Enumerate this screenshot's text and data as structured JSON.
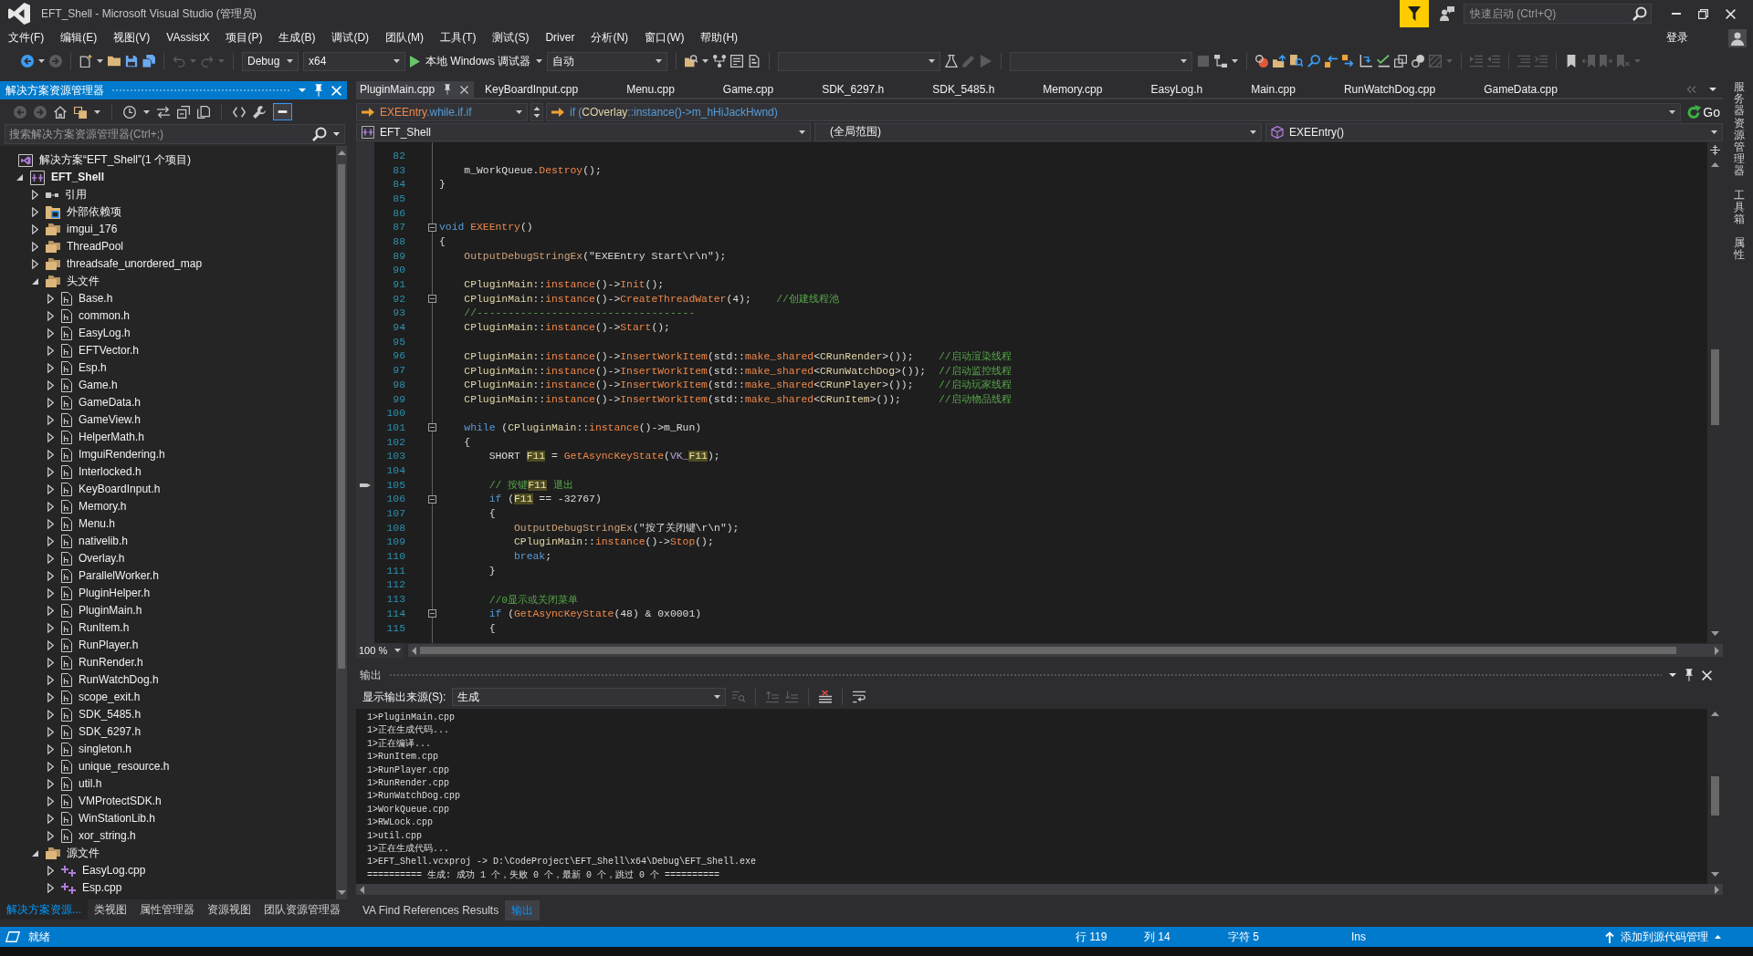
{
  "window": {
    "title": "EFT_Shell - Microsoft Visual Studio (管理员)",
    "quick_launch": {
      "placeholder": "快速启动 (Ctrl+Q)"
    },
    "sign_in": "登录"
  },
  "menu": [
    "文件(F)",
    "编辑(E)",
    "视图(V)",
    "VAssistX",
    "项目(P)",
    "生成(B)",
    "调试(D)",
    "团队(M)",
    "工具(T)",
    "测试(S)",
    "Driver",
    "分析(N)",
    "窗口(W)",
    "帮助(H)"
  ],
  "toolbar": {
    "groups": [
      [
        {
          "kind": "button",
          "disabled": false
        },
        {
          "kind": "button",
          "disabled": true
        }
      ],
      [
        {
          "kind": "button",
          "disabled": false
        },
        {
          "kind": "button",
          "disabled": false
        },
        {
          "kind": "button",
          "disabled": false
        },
        {
          "kind": "button",
          "disabled": false
        }
      ],
      [
        {
          "kind": "button",
          "disabled": true
        },
        {
          "kind": "button",
          "disabled": true
        }
      ],
      [
        {
          "kind": "dropdown",
          "value": "Debug"
        },
        {
          "kind": "dropdown",
          "value": "x64"
        },
        {
          "kind": "start",
          "label": "本地 Windows 调试器"
        },
        {
          "kind": "dropdown",
          "value": "自动"
        }
      ],
      [
        {
          "kind": "button",
          "disabled": false
        },
        {
          "kind": "button",
          "disabled": false
        },
        {
          "kind": "button",
          "disabled": false
        },
        {
          "kind": "button",
          "disabled": false
        }
      ],
      [
        {
          "kind": "dropdown"
        },
        {
          "kind": "button",
          "disabled": false
        },
        {
          "kind": "button",
          "disabled": true
        },
        {
          "kind": "button",
          "disabled": true
        }
      ],
      [
        {
          "kind": "dropdown"
        },
        {
          "kind": "button",
          "disabled": true
        },
        {
          "kind": "button",
          "disabled": false
        }
      ],
      [
        {
          "kind": "button",
          "disabled": false
        },
        {
          "kind": "button",
          "disabled": false
        },
        {
          "kind": "button",
          "disabled": false
        },
        {
          "kind": "button",
          "disabled": false
        },
        {
          "kind": "button",
          "disabled": false
        },
        {
          "kind": "button",
          "disabled": false
        },
        {
          "kind": "button",
          "disabled": false
        },
        {
          "kind": "button",
          "disabled": false
        },
        {
          "kind": "button",
          "disabled": false
        },
        {
          "kind": "button",
          "disabled": false
        },
        {
          "kind": "button",
          "disabled": true
        }
      ],
      [
        {
          "kind": "button",
          "disabled": true
        },
        {
          "kind": "button",
          "disabled": true
        }
      ],
      [
        {
          "kind": "button",
          "disabled": true
        },
        {
          "kind": "button",
          "disabled": true
        }
      ],
      [
        {
          "kind": "button",
          "disabled": false
        },
        {
          "kind": "button",
          "disabled": true
        },
        {
          "kind": "button",
          "disabled": true
        },
        {
          "kind": "button",
          "disabled": true
        }
      ]
    ]
  },
  "solution_explorer": {
    "title": "解决方案资源管理器",
    "toolbar": [
      {
        "disabled": true,
        "on": false
      },
      {
        "disabled": true,
        "on": false
      },
      {
        "disabled": false,
        "on": false
      },
      {
        "disabled": false,
        "on": false
      },
      {
        "disabled": false,
        "on": false
      },
      {
        "disabled": false,
        "on": false
      },
      {
        "disabled": false,
        "on": false
      },
      {
        "disabled": false,
        "on": false
      },
      {
        "disabled": false,
        "on": false
      },
      {
        "disabled": false,
        "on": false
      },
      {
        "disabled": false,
        "on": true
      }
    ],
    "search": {
      "placeholder": "搜索解决方案资源管理器(Ctrl+;)"
    },
    "solution": {
      "label": "解决方案“EFT_Shell”(1 个项目)",
      "children": [
        {
          "kind": "project",
          "label": "EFT_Shell",
          "expanded": true,
          "children": [
            {
              "kind": "references",
              "label": "引用",
              "expanded": false
            },
            {
              "kind": "external",
              "label": "外部依赖项",
              "expanded": false
            },
            {
              "kind": "filter",
              "label": "imgui_176",
              "expanded": false
            },
            {
              "kind": "filter",
              "label": "ThreadPool",
              "expanded": false
            },
            {
              "kind": "filter",
              "label": "threadsafe_unordered_map",
              "expanded": false
            },
            {
              "kind": "filter",
              "label": "头文件",
              "expanded": true,
              "children": [
                {
                  "kind": "header",
                  "label": "Base.h",
                  "expanded": false
                },
                {
                  "kind": "header",
                  "label": "common.h",
                  "expanded": false
                },
                {
                  "kind": "header",
                  "label": "EasyLog.h",
                  "expanded": false
                },
                {
                  "kind": "header",
                  "label": "EFTVector.h",
                  "expanded": false
                },
                {
                  "kind": "header",
                  "label": "Esp.h",
                  "expanded": false
                },
                {
                  "kind": "header",
                  "label": "Game.h",
                  "expanded": false
                },
                {
                  "kind": "header",
                  "label": "GameData.h",
                  "expanded": false
                },
                {
                  "kind": "header",
                  "label": "GameView.h",
                  "expanded": false
                },
                {
                  "kind": "header",
                  "label": "HelperMath.h",
                  "expanded": false
                },
                {
                  "kind": "header",
                  "label": "ImguiRendering.h",
                  "expanded": false
                },
                {
                  "kind": "header",
                  "label": "Interlocked.h",
                  "expanded": false
                },
                {
                  "kind": "header",
                  "label": "KeyBoardInput.h",
                  "expanded": false
                },
                {
                  "kind": "header",
                  "label": "Memory.h",
                  "expanded": false
                },
                {
                  "kind": "header",
                  "label": "Menu.h",
                  "expanded": false
                },
                {
                  "kind": "header",
                  "label": "nativelib.h",
                  "expanded": false
                },
                {
                  "kind": "header",
                  "label": "Overlay.h",
                  "expanded": false
                },
                {
                  "kind": "header",
                  "label": "ParallelWorker.h",
                  "expanded": false
                },
                {
                  "kind": "header",
                  "label": "PluginHelper.h",
                  "expanded": false
                },
                {
                  "kind": "header",
                  "label": "PluginMain.h",
                  "expanded": false
                },
                {
                  "kind": "header",
                  "label": "RunItem.h",
                  "expanded": false
                },
                {
                  "kind": "header",
                  "label": "RunPlayer.h",
                  "expanded": false
                },
                {
                  "kind": "header",
                  "label": "RunRender.h",
                  "expanded": false
                },
                {
                  "kind": "header",
                  "label": "RunWatchDog.h",
                  "expanded": false
                },
                {
                  "kind": "header",
                  "label": "scope_exit.h",
                  "expanded": false
                },
                {
                  "kind": "header",
                  "label": "SDK_5485.h",
                  "expanded": false
                },
                {
                  "kind": "header",
                  "label": "SDK_6297.h",
                  "expanded": false
                },
                {
                  "kind": "header",
                  "label": "singleton.h",
                  "expanded": false
                },
                {
                  "kind": "header",
                  "label": "unique_resource.h",
                  "expanded": false
                },
                {
                  "kind": "header",
                  "label": "util.h",
                  "expanded": false
                },
                {
                  "kind": "header",
                  "label": "VMProtectSDK.h",
                  "expanded": false
                },
                {
                  "kind": "header",
                  "label": "WinStationLib.h",
                  "expanded": false
                },
                {
                  "kind": "header",
                  "label": "xor_string.h",
                  "expanded": false
                }
              ]
            },
            {
              "kind": "filter",
              "label": "源文件",
              "expanded": true,
              "children": [
                {
                  "kind": "source",
                  "label": "EasyLog.cpp",
                  "expanded": false
                },
                {
                  "kind": "source",
                  "label": "Esp.cpp",
                  "expanded": false
                }
              ]
            }
          ]
        }
      ]
    },
    "tabs": [
      {
        "label": "解决方案资源...",
        "selected": true
      },
      {
        "label": "类视图",
        "selected": false
      },
      {
        "label": "属性管理器",
        "selected": false
      },
      {
        "label": "资源视图",
        "selected": false
      },
      {
        "label": "团队资源管理器",
        "selected": false
      }
    ]
  },
  "editor": {
    "tabs": [
      {
        "label": "PluginMain.cpp",
        "selected": true
      },
      {
        "label": "KeyBoardInput.cpp",
        "selected": false
      },
      {
        "label": "Menu.cpp",
        "selected": false
      },
      {
        "label": "Game.cpp",
        "selected": false
      },
      {
        "label": "SDK_6297.h",
        "selected": false
      },
      {
        "label": "SDK_5485.h",
        "selected": false
      },
      {
        "label": "Memory.cpp",
        "selected": false
      },
      {
        "label": "EasyLog.h",
        "selected": false
      },
      {
        "label": "Main.cpp",
        "selected": false
      },
      {
        "label": "RunWatchDog.cpp",
        "selected": false
      },
      {
        "label": "GameData.cpp",
        "selected": false
      }
    ],
    "navigation": {
      "scope": [
        {
          "kind": "method",
          "text": "EXEEntry"
        },
        {
          "kind": "keyword",
          "text": ".while.if.if"
        }
      ],
      "context": [
        {
          "kind": "keyword",
          "text": "if ("
        },
        {
          "kind": "type",
          "text": "COverlay"
        },
        {
          "kind": "keyword",
          "text": "::instance()->m_hHiJackHwnd)"
        }
      ],
      "go": "Go",
      "project": "EFT_Shell",
      "range": "(全局范围)",
      "member": "EXEEntry()"
    },
    "lines": [
      {
        "number": "82",
        "fold_box": false,
        "margin_mark": false
      },
      {
        "number": "83",
        "fold_box": false,
        "margin_mark": false,
        "tokens": [
          {
            "kind": "plain",
            "text": "    m_WorkQueue."
          },
          {
            "kind": "method",
            "text": "Destroy"
          },
          {
            "kind": "plain",
            "text": "();"
          }
        ]
      },
      {
        "number": "84",
        "fold_box": false,
        "margin_mark": false,
        "tokens": [
          {
            "kind": "plain",
            "text": "}"
          }
        ]
      },
      {
        "number": "85",
        "fold_box": false,
        "margin_mark": false
      },
      {
        "number": "86",
        "fold_box": false,
        "margin_mark": false
      },
      {
        "number": "87",
        "fold_box": true,
        "margin_mark": false,
        "tokens": [
          {
            "kind": "keyword",
            "text": "void "
          },
          {
            "kind": "method",
            "text": "EXEEntry"
          },
          {
            "kind": "plain",
            "text": "()"
          }
        ]
      },
      {
        "number": "88",
        "fold_box": false,
        "margin_mark": false,
        "tokens": [
          {
            "kind": "plain",
            "text": "{"
          }
        ]
      },
      {
        "number": "89",
        "fold_box": false,
        "margin_mark": false,
        "tokens": [
          {
            "kind": "macro",
            "text": "    OutputDebugStringEx"
          },
          {
            "kind": "plain",
            "text": "(\"EXEEntry Start\\r\\n\");"
          }
        ]
      },
      {
        "number": "90",
        "fold_box": false,
        "margin_mark": false
      },
      {
        "number": "91",
        "fold_box": false,
        "margin_mark": false,
        "tokens": [
          {
            "kind": "type",
            "text": "    CPluginMain"
          },
          {
            "kind": "plain",
            "text": "::"
          },
          {
            "kind": "method",
            "text": "instance"
          },
          {
            "kind": "plain",
            "text": "()->"
          },
          {
            "kind": "method",
            "text": "Init"
          },
          {
            "kind": "plain",
            "text": "();"
          }
        ]
      },
      {
        "number": "92",
        "fold_box": true,
        "margin_mark": false,
        "tokens": [
          {
            "kind": "type",
            "text": "    CPluginMain"
          },
          {
            "kind": "plain",
            "text": "::"
          },
          {
            "kind": "method",
            "text": "instance"
          },
          {
            "kind": "plain",
            "text": "()->"
          },
          {
            "kind": "method",
            "text": "CreateThreadWater"
          },
          {
            "kind": "plain",
            "text": "(4);"
          },
          {
            "kind": "comment",
            "text": "    //创建线程池"
          }
        ]
      },
      {
        "number": "93",
        "fold_box": false,
        "margin_mark": false,
        "tokens": [
          {
            "kind": "comment",
            "text": "    //-----------------------------------"
          }
        ]
      },
      {
        "number": "94",
        "fold_box": false,
        "margin_mark": false,
        "tokens": [
          {
            "kind": "type",
            "text": "    CPluginMain"
          },
          {
            "kind": "plain",
            "text": "::"
          },
          {
            "kind": "method",
            "text": "instance"
          },
          {
            "kind": "plain",
            "text": "()->"
          },
          {
            "kind": "method",
            "text": "Start"
          },
          {
            "kind": "plain",
            "text": "();"
          }
        ]
      },
      {
        "number": "95",
        "fold_box": false,
        "margin_mark": false
      },
      {
        "number": "96",
        "fold_box": false,
        "margin_mark": false,
        "tokens": [
          {
            "kind": "type",
            "text": "    CPluginMain"
          },
          {
            "kind": "plain",
            "text": "::"
          },
          {
            "kind": "method",
            "text": "instance"
          },
          {
            "kind": "plain",
            "text": "()->"
          },
          {
            "kind": "method",
            "text": "InsertWorkItem"
          },
          {
            "kind": "plain",
            "text": "(std::"
          },
          {
            "kind": "method",
            "text": "make_shared"
          },
          {
            "kind": "plain",
            "text": "<"
          },
          {
            "kind": "type",
            "text": "CRunRender"
          },
          {
            "kind": "plain",
            "text": ">());"
          },
          {
            "kind": "comment",
            "text": "    //启动渲染线程"
          }
        ]
      },
      {
        "number": "97",
        "fold_box": false,
        "margin_mark": false,
        "tokens": [
          {
            "kind": "type",
            "text": "    CPluginMain"
          },
          {
            "kind": "plain",
            "text": "::"
          },
          {
            "kind": "method",
            "text": "instance"
          },
          {
            "kind": "plain",
            "text": "()->"
          },
          {
            "kind": "method",
            "text": "InsertWorkItem"
          },
          {
            "kind": "plain",
            "text": "(std::"
          },
          {
            "kind": "method",
            "text": "make_shared"
          },
          {
            "kind": "plain",
            "text": "<"
          },
          {
            "kind": "type",
            "text": "CRunWatchDog"
          },
          {
            "kind": "plain",
            "text": ">());"
          },
          {
            "kind": "comment",
            "text": "  //启动监控线程"
          }
        ]
      },
      {
        "number": "98",
        "fold_box": false,
        "margin_mark": false,
        "tokens": [
          {
            "kind": "type",
            "text": "    CPluginMain"
          },
          {
            "kind": "plain",
            "text": "::"
          },
          {
            "kind": "method",
            "text": "instance"
          },
          {
            "kind": "plain",
            "text": "()->"
          },
          {
            "kind": "method",
            "text": "InsertWorkItem"
          },
          {
            "kind": "plain",
            "text": "(std::"
          },
          {
            "kind": "method",
            "text": "make_shared"
          },
          {
            "kind": "plain",
            "text": "<"
          },
          {
            "kind": "type",
            "text": "CRunPlayer"
          },
          {
            "kind": "plain",
            "text": ">());"
          },
          {
            "kind": "comment",
            "text": "    //启动玩家线程"
          }
        ]
      },
      {
        "number": "99",
        "fold_box": false,
        "margin_mark": false,
        "tokens": [
          {
            "kind": "type",
            "text": "    CPluginMain"
          },
          {
            "kind": "plain",
            "text": "::"
          },
          {
            "kind": "method",
            "text": "instance"
          },
          {
            "kind": "plain",
            "text": "()->"
          },
          {
            "kind": "method",
            "text": "InsertWorkItem"
          },
          {
            "kind": "plain",
            "text": "(std::"
          },
          {
            "kind": "method",
            "text": "make_shared"
          },
          {
            "kind": "plain",
            "text": "<"
          },
          {
            "kind": "type",
            "text": "CRunItem"
          },
          {
            "kind": "plain",
            "text": ">());"
          },
          {
            "kind": "comment",
            "text": "      //启动物品线程"
          }
        ]
      },
      {
        "number": "100",
        "fold_box": false,
        "margin_mark": false
      },
      {
        "number": "101",
        "fold_box": true,
        "margin_mark": false,
        "tokens": [
          {
            "kind": "keyword",
            "text": "    while"
          },
          {
            "kind": "plain",
            "text": " ("
          },
          {
            "kind": "type",
            "text": "CPluginMain"
          },
          {
            "kind": "plain",
            "text": "::"
          },
          {
            "kind": "method",
            "text": "instance"
          },
          {
            "kind": "plain",
            "text": "()->m_Run)"
          }
        ]
      },
      {
        "number": "102",
        "fold_box": false,
        "margin_mark": false,
        "tokens": [
          {
            "kind": "plain",
            "text": "    {"
          }
        ]
      },
      {
        "number": "103",
        "fold_box": false,
        "margin_mark": false,
        "tokens": [
          {
            "kind": "plain",
            "text": "        SHORT "
          },
          {
            "kind": "match",
            "text": "F11"
          },
          {
            "kind": "plain",
            "text": " = "
          },
          {
            "kind": "method",
            "text": "GetAsyncKeyState"
          },
          {
            "kind": "plain",
            "text": "("
          },
          {
            "kind": "constant",
            "text": "VK_"
          },
          {
            "kind": "match",
            "text": "F11"
          },
          {
            "kind": "plain",
            "text": ");"
          }
        ]
      },
      {
        "number": "104",
        "fold_box": false,
        "margin_mark": false
      },
      {
        "number": "105",
        "fold_box": false,
        "margin_mark": true,
        "tokens": [
          {
            "kind": "comment",
            "text": "        // 按键"
          },
          {
            "kind": "match",
            "text": "F11"
          },
          {
            "kind": "comment",
            "text": " 退出"
          }
        ]
      },
      {
        "number": "106",
        "fold_box": true,
        "margin_mark": false,
        "tokens": [
          {
            "kind": "keyword",
            "text": "        if"
          },
          {
            "kind": "plain",
            "text": " ("
          },
          {
            "kind": "match",
            "text": "F11"
          },
          {
            "kind": "plain",
            "text": " == -32767)"
          }
        ]
      },
      {
        "number": "107",
        "fold_box": false,
        "margin_mark": false,
        "tokens": [
          {
            "kind": "plain",
            "text": "        {"
          }
        ]
      },
      {
        "number": "108",
        "fold_box": false,
        "margin_mark": false,
        "tokens": [
          {
            "kind": "macro",
            "text": "            OutputDebugStringEx"
          },
          {
            "kind": "plain",
            "text": "(\"按了关闭键\\r\\n\");"
          }
        ]
      },
      {
        "number": "109",
        "fold_box": false,
        "margin_mark": false,
        "tokens": [
          {
            "kind": "type",
            "text": "            CPluginMain"
          },
          {
            "kind": "plain",
            "text": "::"
          },
          {
            "kind": "method",
            "text": "instance"
          },
          {
            "kind": "plain",
            "text": "()->"
          },
          {
            "kind": "method",
            "text": "Stop"
          },
          {
            "kind": "plain",
            "text": "();"
          }
        ]
      },
      {
        "number": "110",
        "fold_box": false,
        "margin_mark": false,
        "tokens": [
          {
            "kind": "keyword",
            "text": "            break"
          },
          {
            "kind": "plain",
            "text": ";"
          }
        ]
      },
      {
        "number": "111",
        "fold_box": false,
        "margin_mark": false,
        "tokens": [
          {
            "kind": "plain",
            "text": "        }"
          }
        ]
      },
      {
        "number": "112",
        "fold_box": false,
        "margin_mark": false
      },
      {
        "number": "113",
        "fold_box": false,
        "margin_mark": false,
        "tokens": [
          {
            "kind": "comment",
            "text": "        //0显示或关闭菜单"
          }
        ]
      },
      {
        "number": "114",
        "fold_box": true,
        "margin_mark": false,
        "tokens": [
          {
            "kind": "keyword",
            "text": "        if"
          },
          {
            "kind": "plain",
            "text": " ("
          },
          {
            "kind": "method",
            "text": "GetAsyncKeyState"
          },
          {
            "kind": "plain",
            "text": "(48) & 0x0001)"
          }
        ]
      },
      {
        "number": "115",
        "fold_box": false,
        "margin_mark": false,
        "tokens": [
          {
            "kind": "plain",
            "text": "        {"
          }
        ]
      }
    ],
    "zoom": "100 %"
  },
  "output": {
    "title": "输出",
    "source_label": "显示输出来源(S):",
    "source": "生成",
    "toolbar": [
      {
        "disabled": true
      },
      {
        "disabled": true
      },
      {
        "disabled": true
      },
      {
        "disabled": false
      },
      {
        "disabled": false
      }
    ],
    "lines": [
      "1>PluginMain.cpp",
      "1>正在生成代码...",
      "1>正在编译...",
      "1>RunItem.cpp",
      "1>RunPlayer.cpp",
      "1>RunRender.cpp",
      "1>RunWatchDog.cpp",
      "1>WorkQueue.cpp",
      "1>RWLock.cpp",
      "1>util.cpp",
      "1>正在生成代码...",
      "1>EFT_Shell.vcxproj -> D:\\CodeProject\\EFT_Shell\\x64\\Debug\\EFT_Shell.exe",
      "========== 生成: 成功 1 个，失败 0 个，最新 0 个，跳过 0 个 =========="
    ]
  },
  "bottom_tabs": [
    {
      "label": "VA Find References Results",
      "selected": false
    },
    {
      "label": "输出",
      "selected": true
    }
  ],
  "side_tabs": [
    "服务器资源管理器",
    "工具箱",
    "属性"
  ],
  "status_bar": {
    "message": "就绪",
    "line": "行 119",
    "column": "列 14",
    "character": "字符 5",
    "mode": "Ins",
    "source_control": "添加到源代码管理"
  }
}
